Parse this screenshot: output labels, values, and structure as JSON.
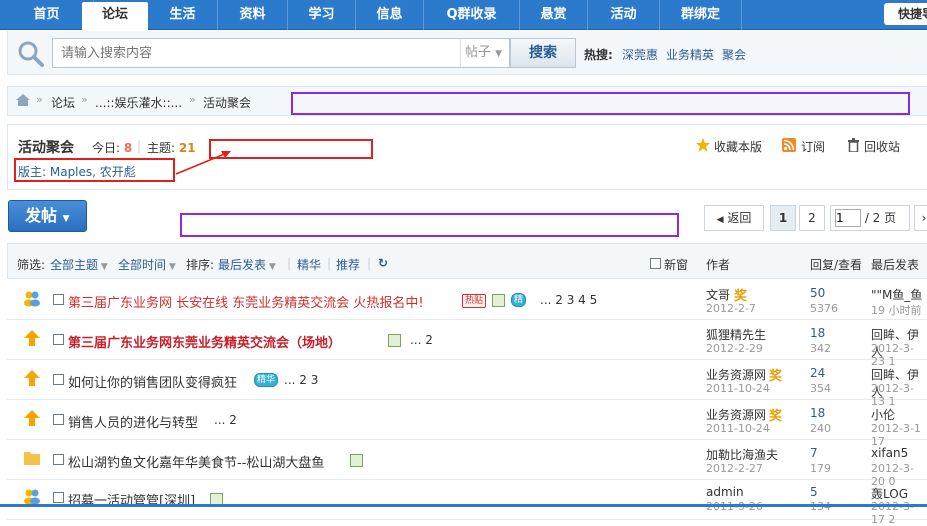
{
  "nav": {
    "tabs": [
      {
        "label": "首页"
      },
      {
        "label": "论坛",
        "active": true
      },
      {
        "label": "生活"
      },
      {
        "label": "资料"
      },
      {
        "label": "学习"
      },
      {
        "label": "信息"
      },
      {
        "label": "Q群收录"
      },
      {
        "label": "悬赏"
      },
      {
        "label": "活动"
      },
      {
        "label": "群绑定"
      }
    ],
    "quick_label": "快捷导"
  },
  "search": {
    "placeholder": "请输入搜索内容",
    "scope": "帖子",
    "button": "搜索",
    "hot_label": "热搜:",
    "hot_terms": [
      "深莞惠",
      "业务精英",
      "聚会"
    ]
  },
  "breadcrumb": [
    "论坛",
    "...::娱乐灌水::...",
    "活动聚会"
  ],
  "forum": {
    "title": "活动聚会",
    "today_label": "今日:",
    "today_count": "8",
    "topics_label": "主题:",
    "topics_count": "21",
    "moderators": "版主: Maples, 农开彪",
    "actions": [
      "收藏本版",
      "订阅",
      "回收站"
    ]
  },
  "toolbar": {
    "post_label": "发帖",
    "back_label": "返回",
    "pages": [
      "1",
      "2"
    ],
    "page_input": "1",
    "page_total": "/ 2 页"
  },
  "filter": {
    "label": "筛选:",
    "all_topics": "全部主题",
    "all_time": "全部时间",
    "sort_label": "排序:",
    "sort_value": "最后发表",
    "digest": "精华",
    "recommend": "推荐",
    "newwin": "新窗",
    "col_author": "作者",
    "col_replies": "回复/查看",
    "col_last": "最后发表"
  },
  "threads": [
    {
      "subject": "第三届广东业务网 长安在线 东莞业务精英交流会 火热报名中!",
      "badges": [
        "热贴"
      ],
      "pages": "... 2  3  4  5",
      "author": "文哥",
      "date": "2012-2-7",
      "replies": "50",
      "views": "5376",
      "last": "\"\"M鱼_鱼",
      "last_time": "19 小时前"
    },
    {
      "subject": "第三届广东业务网东莞业务精英交流会（场地）",
      "badges": [],
      "pages": "... 2",
      "author": "狐狸精先生",
      "date": "2012-2-29",
      "replies": "18",
      "views": "342",
      "last": "回眸、伊人",
      "last_time": "2012-3-23 1"
    },
    {
      "subject": "如何让你的销售团队变得疯狂",
      "badges": [
        "精华"
      ],
      "pages": "... 2  3",
      "author": "业务资源网",
      "date": "2011-10-24",
      "replies": "24",
      "views": "354",
      "last": "回眸、伊人",
      "last_time": "2012-3-13 1"
    },
    {
      "subject": "销售人员的进化与转型",
      "badges": [],
      "pages": "... 2",
      "author": "业务资源网",
      "date": "2011-10-24",
      "replies": "18",
      "views": "240",
      "last": "小伦",
      "last_time": "2012-3-1 17"
    },
    {
      "subject": "松山湖钓鱼文化嘉年华美食节--松山湖大盘鱼",
      "badges": [],
      "pages": "",
      "author": "加勒比海渔夫",
      "date": "2012-2-27",
      "replies": "7",
      "views": "179",
      "last": "xifan5",
      "last_time": "2012-3-20 0"
    },
    {
      "subject": "招募一活动管管[深圳]",
      "badges": [],
      "pages": "",
      "author": "admin",
      "date": "2011-9-26",
      "replies": "5",
      "views": "134",
      "last": "轰LOG",
      "last_time": "2012-3-17 2"
    }
  ],
  "colors": {
    "accent": "#2b7acc",
    "annotation_red": "#e0201c",
    "annotation_purple": "#8a2be2"
  }
}
